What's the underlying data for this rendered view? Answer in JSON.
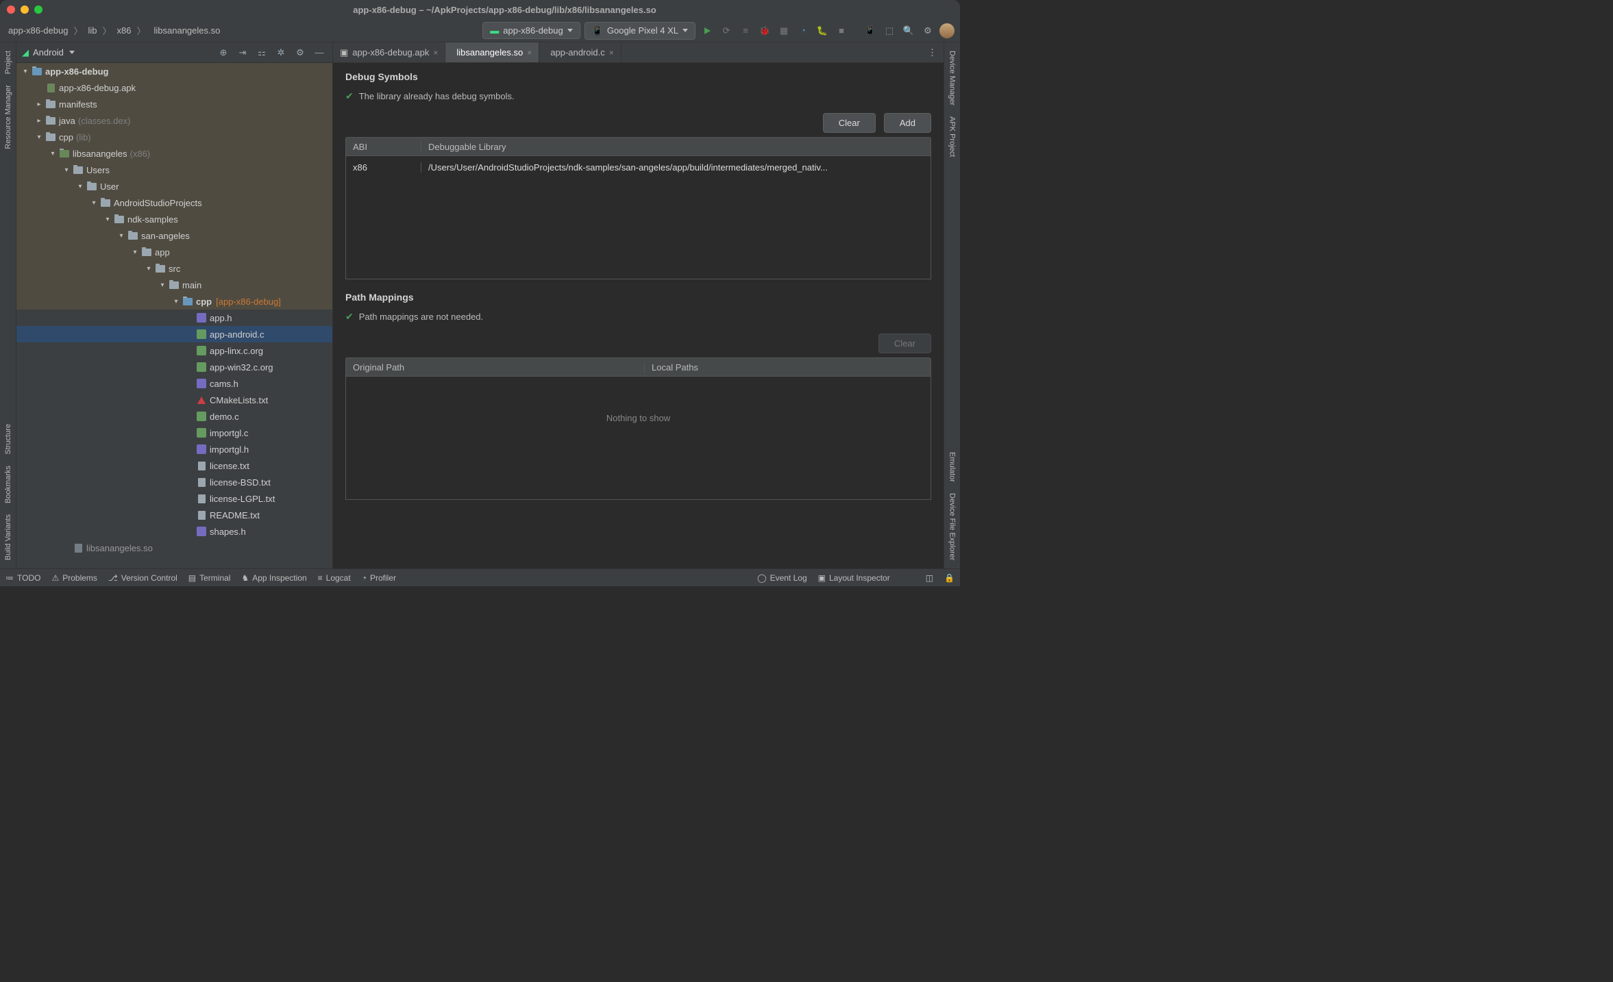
{
  "title": "app-x86-debug – ~/ApkProjects/app-x86-debug/lib/x86/libsanangeles.so",
  "breadcrumb": [
    "app-x86-debug",
    "lib",
    "x86",
    "libsanangeles.so"
  ],
  "run_config": "app-x86-debug",
  "device": "Google Pixel 4 XL",
  "left_tabs": [
    "Project",
    "Resource Manager",
    "Structure",
    "Bookmarks",
    "Build Variants"
  ],
  "right_tabs": [
    "Device Manager",
    "APK Project",
    "Emulator",
    "Device File Explorer"
  ],
  "sidebar_header": "Android",
  "tree": [
    {
      "depth": 0,
      "exp": "▾",
      "icon": "module",
      "label": "app-x86-debug",
      "bold": true,
      "hl": true
    },
    {
      "depth": 1,
      "exp": "",
      "icon": "apk",
      "label": "app-x86-debug.apk",
      "hl": true
    },
    {
      "depth": 1,
      "exp": "▸",
      "icon": "folder",
      "label": "manifests",
      "hl": true
    },
    {
      "depth": 1,
      "exp": "▸",
      "icon": "folder",
      "label": "java",
      "muted": "(classes.dex)",
      "hl": true
    },
    {
      "depth": 1,
      "exp": "▾",
      "icon": "folder",
      "label": "cpp",
      "muted": "(lib)",
      "hl": true
    },
    {
      "depth": 2,
      "exp": "▾",
      "icon": "pkg",
      "label": "libsanangeles",
      "muted": "(x86)",
      "hl": true
    },
    {
      "depth": 3,
      "exp": "▾",
      "icon": "folder",
      "label": "Users",
      "hl": true
    },
    {
      "depth": 4,
      "exp": "▾",
      "icon": "folder",
      "label": "User",
      "hl": true
    },
    {
      "depth": 5,
      "exp": "▾",
      "icon": "folder",
      "label": "AndroidStudioProjects",
      "hl": true
    },
    {
      "depth": 6,
      "exp": "▾",
      "icon": "folder",
      "label": "ndk-samples",
      "hl": true
    },
    {
      "depth": 7,
      "exp": "▾",
      "icon": "folder",
      "label": "san-angeles",
      "hl": true
    },
    {
      "depth": 8,
      "exp": "▾",
      "icon": "folder",
      "label": "app",
      "hl": true
    },
    {
      "depth": 9,
      "exp": "▾",
      "icon": "folder",
      "label": "src",
      "hl": true
    },
    {
      "depth": 10,
      "exp": "▾",
      "icon": "folder",
      "label": "main",
      "hl": true
    },
    {
      "depth": 11,
      "exp": "▾",
      "icon": "module",
      "label": "cpp",
      "orange": "[app-x86-debug]",
      "bold": true,
      "hl": true
    },
    {
      "depth": 12,
      "exp": "",
      "icon": "h",
      "label": "app.h"
    },
    {
      "depth": 12,
      "exp": "",
      "icon": "c",
      "label": "app-android.c",
      "selected": true
    },
    {
      "depth": 12,
      "exp": "",
      "icon": "c",
      "label": "app-linx.c.org"
    },
    {
      "depth": 12,
      "exp": "",
      "icon": "c",
      "label": "app-win32.c.org"
    },
    {
      "depth": 12,
      "exp": "",
      "icon": "h",
      "label": "cams.h"
    },
    {
      "depth": 12,
      "exp": "",
      "icon": "cmake",
      "label": "CMakeLists.txt"
    },
    {
      "depth": 12,
      "exp": "",
      "icon": "c",
      "label": "demo.c"
    },
    {
      "depth": 12,
      "exp": "",
      "icon": "c",
      "label": "importgl.c"
    },
    {
      "depth": 12,
      "exp": "",
      "icon": "h",
      "label": "importgl.h"
    },
    {
      "depth": 12,
      "exp": "",
      "icon": "txt",
      "label": "license.txt"
    },
    {
      "depth": 12,
      "exp": "",
      "icon": "txt",
      "label": "license-BSD.txt"
    },
    {
      "depth": 12,
      "exp": "",
      "icon": "txt",
      "label": "license-LGPL.txt"
    },
    {
      "depth": 12,
      "exp": "",
      "icon": "txt",
      "label": "README.txt"
    },
    {
      "depth": 12,
      "exp": "",
      "icon": "h",
      "label": "shapes.h"
    },
    {
      "depth": 3,
      "exp": "",
      "icon": "txt",
      "label": "libsanangeles.so",
      "dim": true
    }
  ],
  "editor_tabs": [
    {
      "label": "app-x86-debug.apk",
      "active": false
    },
    {
      "label": "libsanangeles.so",
      "active": true
    },
    {
      "label": "app-android.c",
      "active": false
    }
  ],
  "debug": {
    "title": "Debug Symbols",
    "status": "The library already has debug symbols.",
    "btn_clear": "Clear",
    "btn_add": "Add",
    "col_abi": "ABI",
    "col_lib": "Debuggable Library",
    "row_abi": "x86",
    "row_lib": "/Users/User/AndroidStudioProjects/ndk-samples/san-angeles/app/build/intermediates/merged_nativ..."
  },
  "pathmap": {
    "title": "Path Mappings",
    "status": "Path mappings are not needed.",
    "btn_clear": "Clear",
    "col_op": "Original Path",
    "col_lp": "Local Paths",
    "empty": "Nothing to show"
  },
  "status_bar": {
    "todo": "TODO",
    "problems": "Problems",
    "vcs": "Version Control",
    "terminal": "Terminal",
    "appinsp": "App Inspection",
    "logcat": "Logcat",
    "profiler": "Profiler",
    "eventlog": "Event Log",
    "layoutinsp": "Layout Inspector"
  }
}
